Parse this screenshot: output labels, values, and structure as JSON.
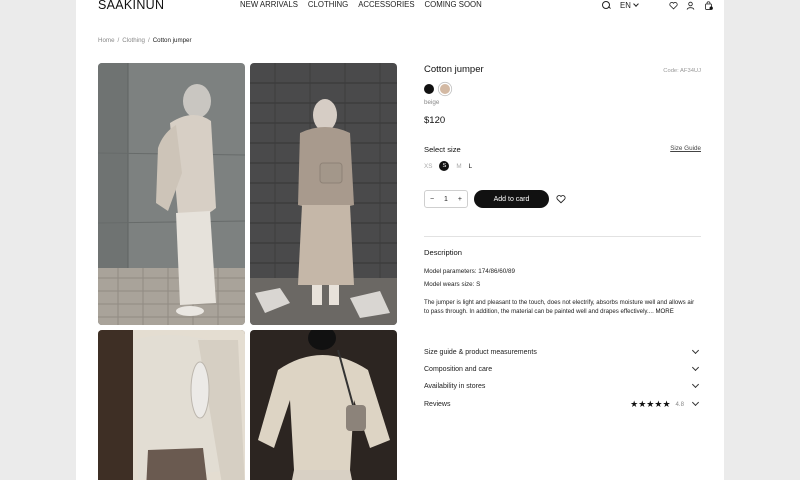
{
  "header": {
    "logo": "SAAKINUN",
    "nav": [
      "NEW ARRIVALS",
      "CLOTHING",
      "ACCESSORIES",
      "COMING SOON"
    ],
    "language": "EN",
    "icons": [
      "search-icon",
      "chevron-down-icon",
      "heart-icon",
      "user-icon",
      "bag-icon"
    ]
  },
  "breadcrumb": {
    "items": [
      "Home",
      "Clothing",
      "Cotton jumper"
    ],
    "separator": "/"
  },
  "product": {
    "title": "Cotton jumper",
    "code": "Code: AF34UJ",
    "colors": [
      {
        "name": "black",
        "hex": "#111111"
      },
      {
        "name": "beige",
        "hex": "#d3b9a3"
      }
    ],
    "selected_color": "beige",
    "price": "$120",
    "select_size_label": "Select size",
    "size_guide_label": "Size Guide",
    "sizes": [
      "XS",
      "S",
      "M",
      "L"
    ],
    "selected_size": "S",
    "quantity": "1",
    "qty_minus": "−",
    "qty_plus": "+",
    "add_to_cart": "Add to card"
  },
  "description": {
    "heading": "Description",
    "model_parameters": "Model parameters: 174/86/60/89",
    "model_size": "Model wears size: S",
    "text": "The jumper is light and pleasant to the touch, does not electrify, absorbs moisture well and allows air to pass through. In addition, the material can be painted well and drapes effectively.... ",
    "more": "MORE"
  },
  "accordions": [
    {
      "label": "Size guide & product measurements"
    },
    {
      "label": "Composition and care"
    },
    {
      "label": "Availability in stores"
    },
    {
      "label": "Reviews"
    }
  ],
  "reviews": {
    "stars": "★★★★★",
    "rating": "4.8"
  },
  "colors": {
    "accent": "#111111",
    "background": "#ebebeb",
    "page": "#ffffff"
  }
}
